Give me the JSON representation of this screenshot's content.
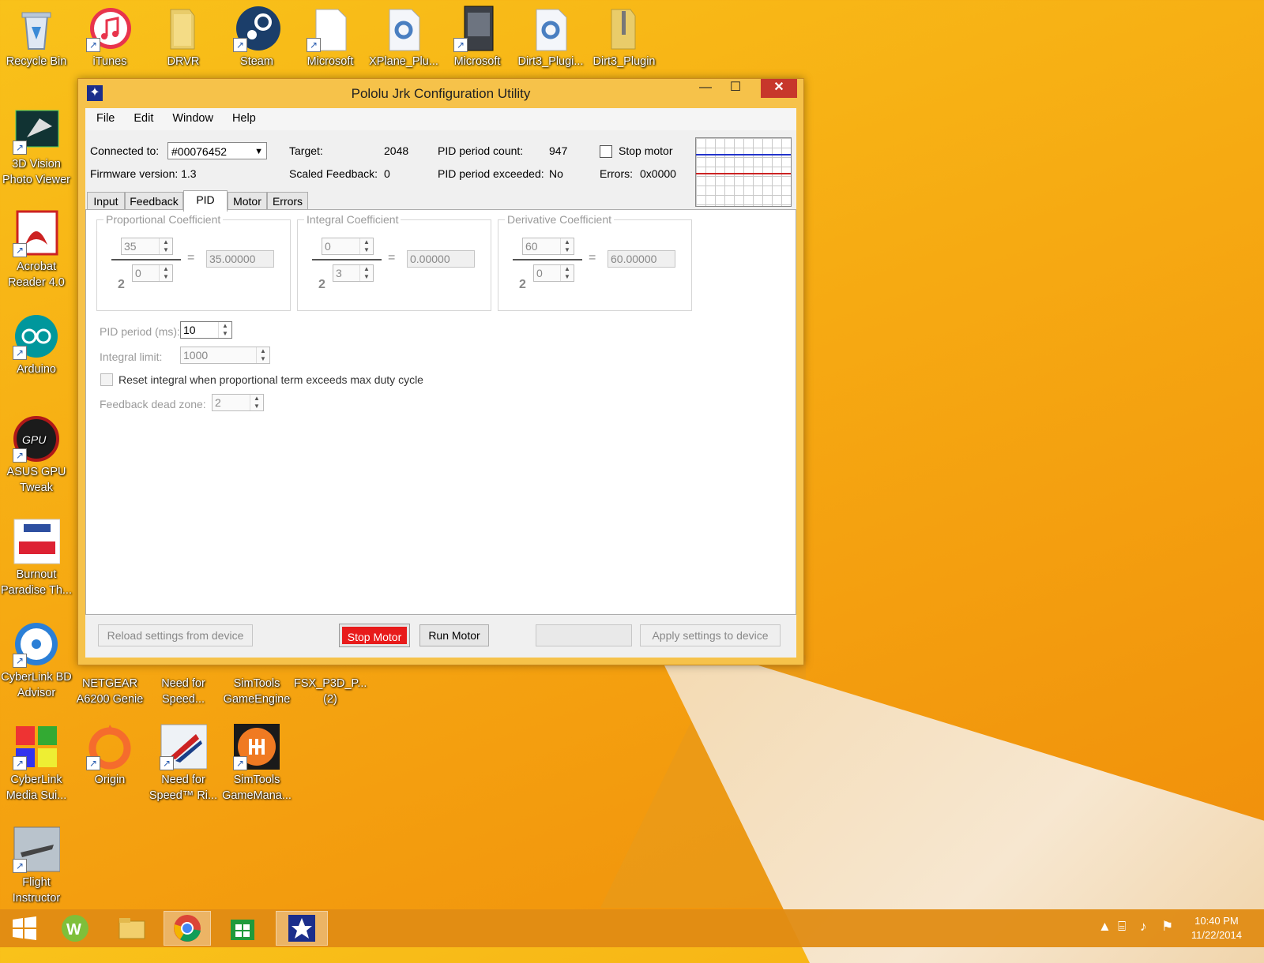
{
  "desktop": {
    "top_row": [
      "Recycle Bin",
      "iTunes",
      "DRVR",
      "Steam",
      "Microsoft",
      "XPlane_Plu...",
      "Microsoft",
      "Dirt3_Plugi...",
      "Dirt3_Plugin"
    ],
    "left_column": [
      {
        "l1": "3D Vision",
        "l2": "Photo Viewer"
      },
      {
        "l1": "Acrobat",
        "l2": "Reader 4.0"
      },
      {
        "l1": "Arduino",
        "l2": ""
      },
      {
        "l1": "ASUS GPU",
        "l2": "Tweak"
      },
      {
        "l1": "Burnout",
        "l2": "Paradise Th..."
      },
      {
        "l1": "CyberLink BD",
        "l2": "Advisor"
      },
      {
        "l1": "CyberLink",
        "l2": "Media Sui..."
      },
      {
        "l1": "Flight",
        "l2": "Instructor"
      }
    ],
    "row_mid": [
      {
        "l1": "NETGEAR",
        "l2": "A6200 Genie"
      },
      {
        "l1": "Need for",
        "l2": "Speed..."
      },
      {
        "l1": "SimTools",
        "l2": "GameEngine"
      },
      {
        "l1": "FSX_P3D_P...",
        "l2": "(2)"
      }
    ],
    "row_low": [
      {
        "l1": "Origin",
        "l2": ""
      },
      {
        "l1": "Need for",
        "l2": "Speed™ Ri..."
      },
      {
        "l1": "SimTools",
        "l2": "GameMana..."
      }
    ]
  },
  "window": {
    "title": "Pololu Jrk Configuration Utility",
    "menu": [
      "File",
      "Edit",
      "Window",
      "Help"
    ],
    "status": {
      "connected_label": "Connected to:",
      "connected_value": "#00076452",
      "firmware_label": "Firmware version: 1.3",
      "target_label": "Target:",
      "target_value": "2048",
      "scaled_feedback_label": "Scaled Feedback:",
      "scaled_feedback_value": "0",
      "pid_count_label": "PID period count:",
      "pid_count_value": "947",
      "pid_exceeded_label": "PID period exceeded:",
      "pid_exceeded_value": "No",
      "stop_motor_label": "Stop motor",
      "errors_label": "Errors:",
      "errors_value": "0x0000"
    },
    "tabs": [
      "Input",
      "Feedback",
      "PID",
      "Motor",
      "Errors"
    ],
    "active_tab": "PID",
    "pid": {
      "proportional": {
        "title": "Proportional Coefficient",
        "mult": "35",
        "exp": "0",
        "base": "2",
        "result": "35.00000"
      },
      "integral": {
        "title": "Integral Coefficient",
        "mult": "0",
        "exp": "3",
        "base": "2",
        "result": "0.00000"
      },
      "derivative": {
        "title": "Derivative Coefficient",
        "mult": "60",
        "exp": "0",
        "base": "2",
        "result": "60.00000"
      },
      "equals": "=",
      "pid_period_label": "PID period (ms):",
      "pid_period_value": "10",
      "integral_limit_label": "Integral limit:",
      "integral_limit_value": "1000",
      "reset_integral_label": "Reset integral when proportional term exceeds max duty cycle",
      "dead_zone_label": "Feedback dead zone:",
      "dead_zone_value": "2"
    },
    "buttons": {
      "reload": "Reload settings from device",
      "stop": "Stop Motor",
      "run": "Run Motor",
      "apply": "Apply settings to device"
    }
  },
  "taskbar": {
    "time": "10:40 PM",
    "date": "11/22/2014"
  },
  "colors": {
    "stop_button": "#e81b1b",
    "graph_blue": "#2233cc",
    "graph_red": "#cc2222",
    "close_button": "#c7372b"
  }
}
